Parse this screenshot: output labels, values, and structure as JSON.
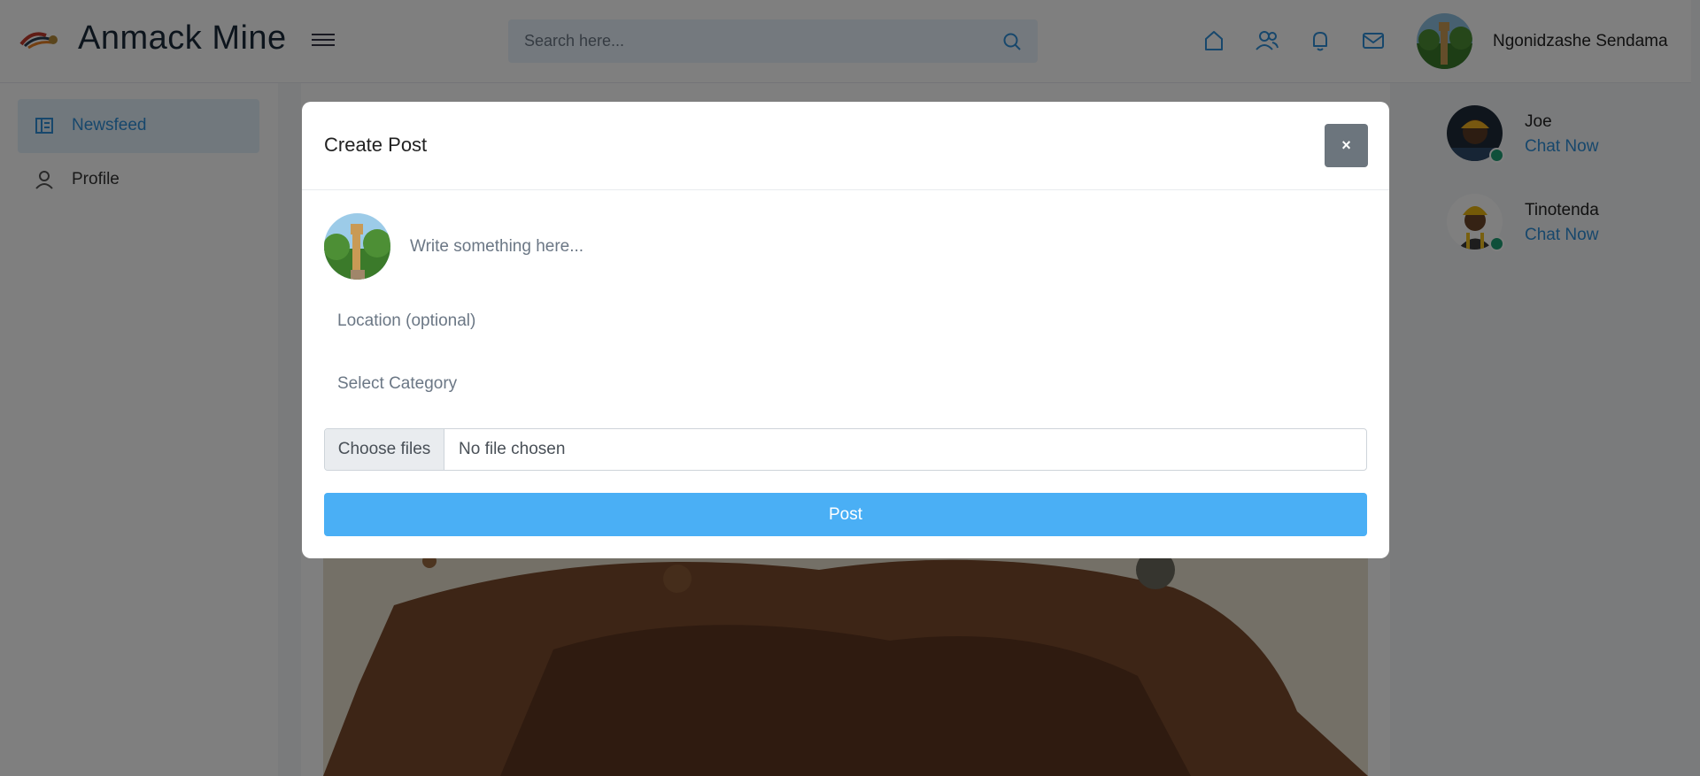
{
  "header": {
    "app_title": "Anmack Mine",
    "search_placeholder": "Search here...",
    "user_name": "Ngonidzashe Sendama",
    "nav_icons": [
      "home-icon",
      "friends-icon",
      "bell-icon",
      "mail-icon"
    ]
  },
  "sidebar": {
    "items": [
      {
        "label": "Newsfeed",
        "icon": "newsfeed-icon",
        "active": true
      },
      {
        "label": "Profile",
        "icon": "user-icon",
        "active": false
      }
    ]
  },
  "chat": {
    "contacts": [
      {
        "name": "Joe",
        "action": "Chat Now",
        "online": true
      },
      {
        "name": "Tinotenda",
        "action": "Chat Now",
        "online": true
      }
    ]
  },
  "modal": {
    "title": "Create Post",
    "close_label": "×",
    "post_placeholder": "Write something here...",
    "location_placeholder": "Location (optional)",
    "category_placeholder": "Select Category",
    "file_button_label": "Choose files",
    "file_status": "No file chosen",
    "submit_label": "Post"
  },
  "colors": {
    "accent": "#2e8fd8",
    "post_button": "#4aaff5",
    "online": "#1f9e75",
    "close_button": "#6c757d"
  }
}
